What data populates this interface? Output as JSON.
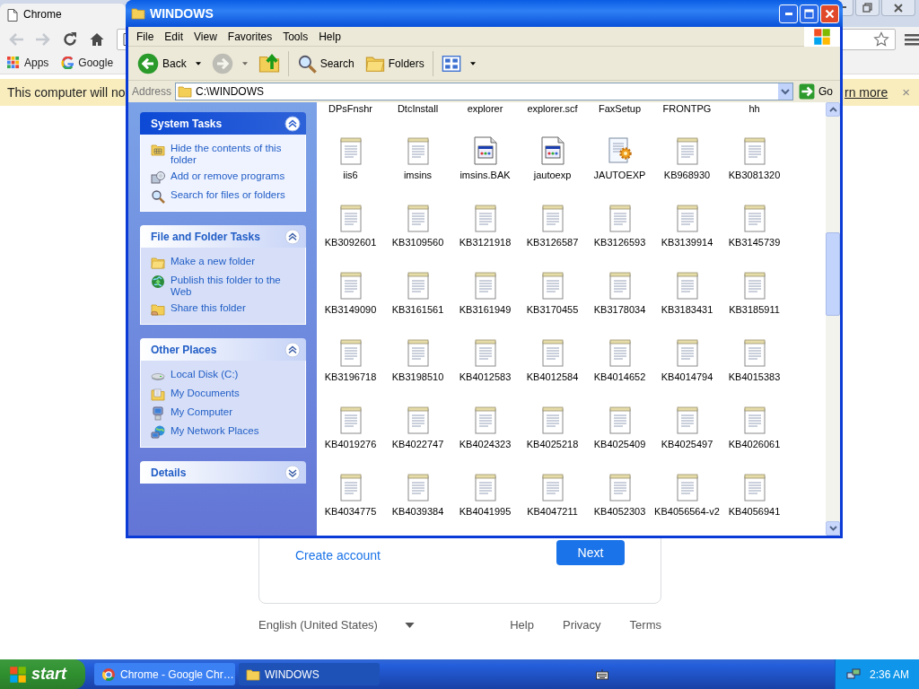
{
  "chrome": {
    "tab_title": "Chrome",
    "nav": [
      {
        "kind": "back",
        "disabled": true
      },
      {
        "kind": "forward",
        "disabled": true
      },
      {
        "kind": "reload",
        "disabled": false
      },
      {
        "kind": "home",
        "disabled": false
      }
    ],
    "bookmarks": [
      {
        "label": "Apps",
        "kind": "apps"
      },
      {
        "label": "Google",
        "kind": "google"
      }
    ],
    "infobar": {
      "message": "This computer will no",
      "link": "rn more",
      "close": "×"
    },
    "page": {
      "create_account": "Create account",
      "next": "Next",
      "language": "English (United States)",
      "footer_links": [
        "Help",
        "Privacy",
        "Terms"
      ]
    }
  },
  "explorer": {
    "title": "WINDOWS",
    "menu": [
      "File",
      "Edit",
      "View",
      "Favorites",
      "Tools",
      "Help"
    ],
    "toolbar": [
      [
        {
          "kind": "back",
          "label": "Back",
          "disabled": false,
          "dropdown": true
        },
        {
          "kind": "forward",
          "disabled": true,
          "dropdown": true
        },
        {
          "kind": "up",
          "disabled": false,
          "dropdown": false
        }
      ],
      [
        {
          "kind": "search",
          "label": "Search",
          "disabled": false,
          "dropdown": false
        },
        {
          "kind": "folders",
          "label": "Folders",
          "disabled": false,
          "dropdown": false
        }
      ],
      [
        {
          "kind": "views",
          "disabled": false,
          "dropdown": true
        }
      ]
    ],
    "address": {
      "label": "Address",
      "value": "C:\\WINDOWS",
      "go": "Go"
    },
    "sidebar": [
      {
        "title": "System Tasks",
        "kind": "special",
        "expanded": true,
        "items": [
          {
            "label": "Hide the contents of this folder",
            "kind": "grid-folder"
          },
          {
            "label": "Add or remove programs",
            "kind": "programs"
          },
          {
            "label": "Search for files or folders",
            "kind": "search"
          }
        ]
      },
      {
        "title": "File and Folder Tasks",
        "kind": "normal",
        "expanded": true,
        "items": [
          {
            "label": "Make a new folder",
            "kind": "new-folder"
          },
          {
            "label": "Publish this folder to the Web",
            "kind": "globe"
          },
          {
            "label": "Share this folder",
            "kind": "share"
          }
        ]
      },
      {
        "title": "Other Places",
        "kind": "normal",
        "expanded": true,
        "items": [
          {
            "label": "Local Disk (C:)",
            "kind": "disk"
          },
          {
            "label": "My Documents",
            "kind": "documents"
          },
          {
            "label": "My Computer",
            "kind": "computer"
          },
          {
            "label": "My Network Places",
            "kind": "network"
          }
        ]
      },
      {
        "title": "Details",
        "kind": "normal",
        "expanded": false
      }
    ],
    "file_rows": [
      [
        {
          "name": "DPsFnshr",
          "kind": "name-only"
        },
        {
          "name": "DtcInstall",
          "kind": "name-only"
        },
        {
          "name": "explorer",
          "kind": "name-only"
        },
        {
          "name": "explorer.scf",
          "kind": "name-only"
        },
        {
          "name": "FaxSetup",
          "kind": "name-only"
        },
        {
          "name": "FRONTPG",
          "kind": "name-only"
        },
        {
          "name": "hh",
          "kind": "name-only"
        }
      ],
      [
        {
          "name": "iis6",
          "kind": "text"
        },
        {
          "name": "imsins",
          "kind": "text"
        },
        {
          "name": "imsins.BAK",
          "kind": "window"
        },
        {
          "name": "jautoexp",
          "kind": "window"
        },
        {
          "name": "JAUTOEXP",
          "kind": "setup"
        },
        {
          "name": "KB968930",
          "kind": "text"
        },
        {
          "name": "KB3081320",
          "kind": "text"
        }
      ],
      [
        {
          "name": "KB3092601",
          "kind": "text"
        },
        {
          "name": "KB3109560",
          "kind": "text"
        },
        {
          "name": "KB3121918",
          "kind": "text"
        },
        {
          "name": "KB3126587",
          "kind": "text"
        },
        {
          "name": "KB3126593",
          "kind": "text"
        },
        {
          "name": "KB3139914",
          "kind": "text"
        },
        {
          "name": "KB3145739",
          "kind": "text"
        }
      ],
      [
        {
          "name": "KB3149090",
          "kind": "text"
        },
        {
          "name": "KB3161561",
          "kind": "text"
        },
        {
          "name": "KB3161949",
          "kind": "text"
        },
        {
          "name": "KB3170455",
          "kind": "text"
        },
        {
          "name": "KB3178034",
          "kind": "text"
        },
        {
          "name": "KB3183431",
          "kind": "text"
        },
        {
          "name": "KB3185911",
          "kind": "text"
        }
      ],
      [
        {
          "name": "KB3196718",
          "kind": "text"
        },
        {
          "name": "KB3198510",
          "kind": "text"
        },
        {
          "name": "KB4012583",
          "kind": "text"
        },
        {
          "name": "KB4012584",
          "kind": "text"
        },
        {
          "name": "KB4014652",
          "kind": "text"
        },
        {
          "name": "KB4014794",
          "kind": "text"
        },
        {
          "name": "KB4015383",
          "kind": "text"
        }
      ],
      [
        {
          "name": "KB4019276",
          "kind": "text"
        },
        {
          "name": "KB4022747",
          "kind": "text"
        },
        {
          "name": "KB4024323",
          "kind": "text"
        },
        {
          "name": "KB4025218",
          "kind": "text"
        },
        {
          "name": "KB4025409",
          "kind": "text"
        },
        {
          "name": "KB4025497",
          "kind": "text"
        },
        {
          "name": "KB4026061",
          "kind": "text"
        }
      ],
      [
        {
          "name": "KB4034775",
          "kind": "text"
        },
        {
          "name": "KB4039384",
          "kind": "text"
        },
        {
          "name": "KB4041995",
          "kind": "text"
        },
        {
          "name": "KB4047211",
          "kind": "text"
        },
        {
          "name": "KB4052303",
          "kind": "text"
        },
        {
          "name": "KB4056564-v2",
          "kind": "text"
        },
        {
          "name": "KB4056941",
          "kind": "text"
        }
      ]
    ]
  },
  "taskbar": {
    "start": "start",
    "tasks": [
      {
        "label": "Chrome - Google Chr…",
        "kind": "chrome",
        "selected": false
      },
      {
        "label": "WINDOWS",
        "kind": "folder",
        "selected": true
      }
    ],
    "clock": "2:36 AM"
  }
}
